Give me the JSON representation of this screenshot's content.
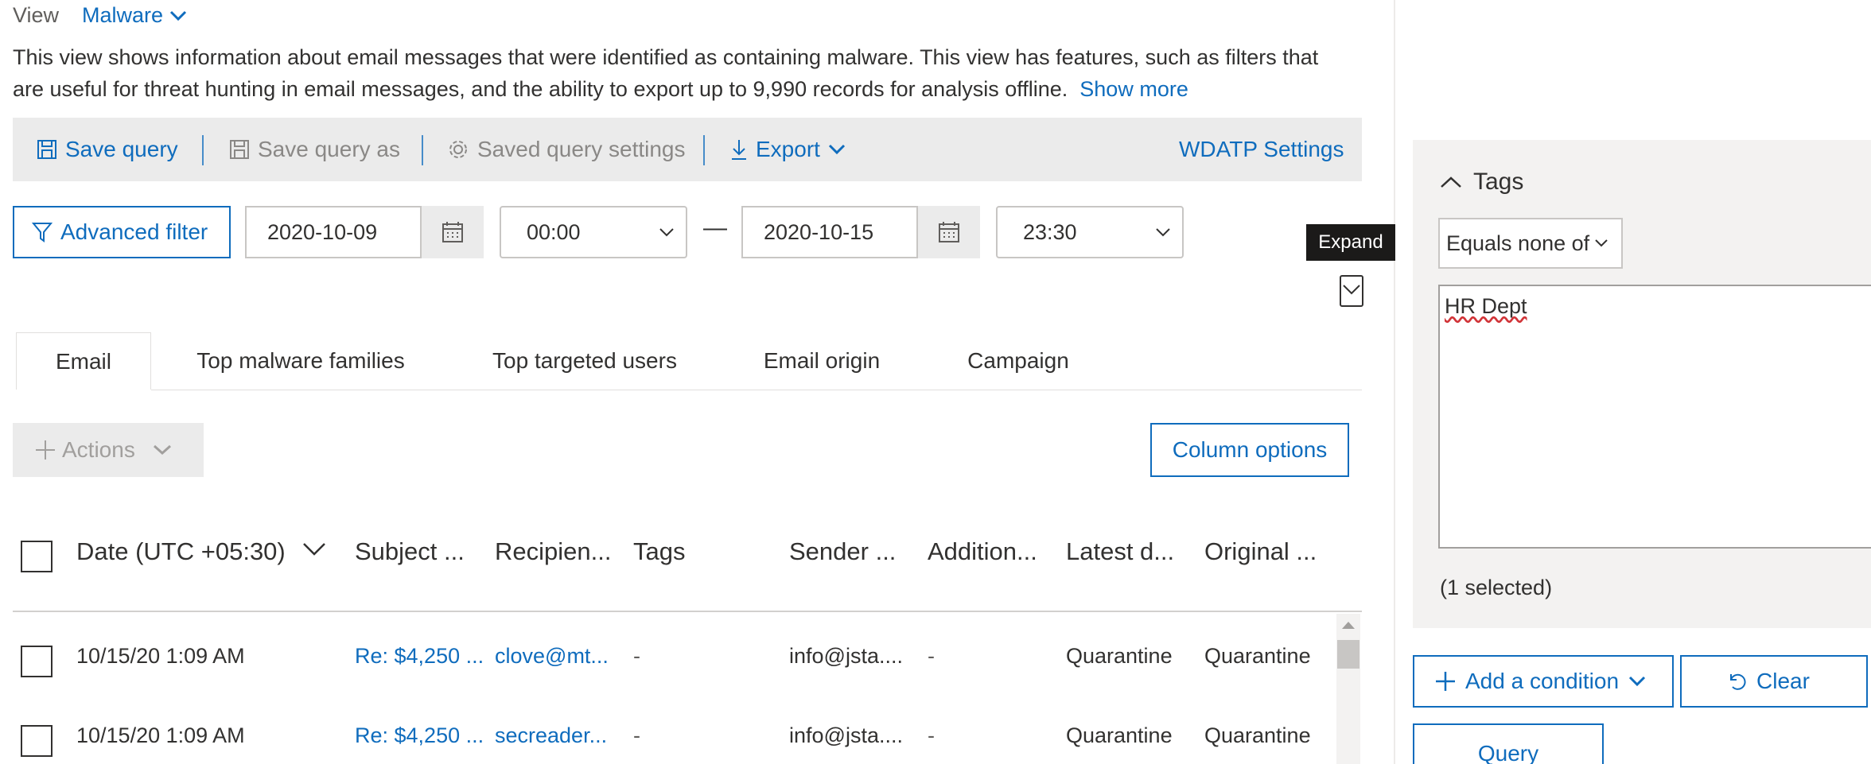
{
  "view": {
    "label": "View",
    "value": "Malware"
  },
  "description": {
    "line1": "This view shows information about email messages that were identified as containing malware. This view has features, such as filters that",
    "line2": "are useful for threat hunting in email messages, and the ability to export up to 9,990 records for analysis offline.",
    "show_more": "Show more"
  },
  "command_bar": {
    "save_query": "Save query",
    "save_query_as": "Save query as",
    "saved_query_settings": "Saved query settings",
    "export": "Export",
    "wdatp_settings": "WDATP Settings"
  },
  "filters": {
    "advanced_filter": "Advanced filter",
    "start_date": "2020-10-09",
    "start_time": "00:00",
    "separator": "—",
    "end_date": "2020-10-15",
    "end_time": "23:30"
  },
  "tabs": [
    "Email",
    "Top malware families",
    "Top targeted users",
    "Email origin",
    "Campaign"
  ],
  "actions": {
    "label": "Actions",
    "column_options": "Column options"
  },
  "table": {
    "columns": [
      "Date (UTC +05:30)",
      "Subject ...",
      "Recipien...",
      "Tags",
      "Sender ...",
      "Addition...",
      "Latest d...",
      "Original ..."
    ],
    "rows": [
      [
        "10/15/20 1:09 AM",
        "Re: $4,250 ...",
        "clove@mt...",
        "-",
        "info@jsta....",
        "-",
        "Quarantine",
        "Quarantine"
      ],
      [
        "10/15/20 1:09 AM",
        "Re: $4,250 ...",
        "secreader...",
        "-",
        "info@jsta....",
        "-",
        "Quarantine",
        "Quarantine"
      ]
    ]
  },
  "tooltip": {
    "text": "Expand"
  },
  "tags_panel": {
    "title": "Tags",
    "operator": "Equals none of",
    "value": "HR Dept",
    "count": "(1 selected)"
  },
  "panel_buttons": {
    "add_condition": "Add a condition",
    "clear": "Clear",
    "query": "Query"
  },
  "colors": {
    "accent": "#0f6cbd",
    "command_bar_bg": "#ebebeb",
    "panel_bg": "#f3f2f1"
  }
}
